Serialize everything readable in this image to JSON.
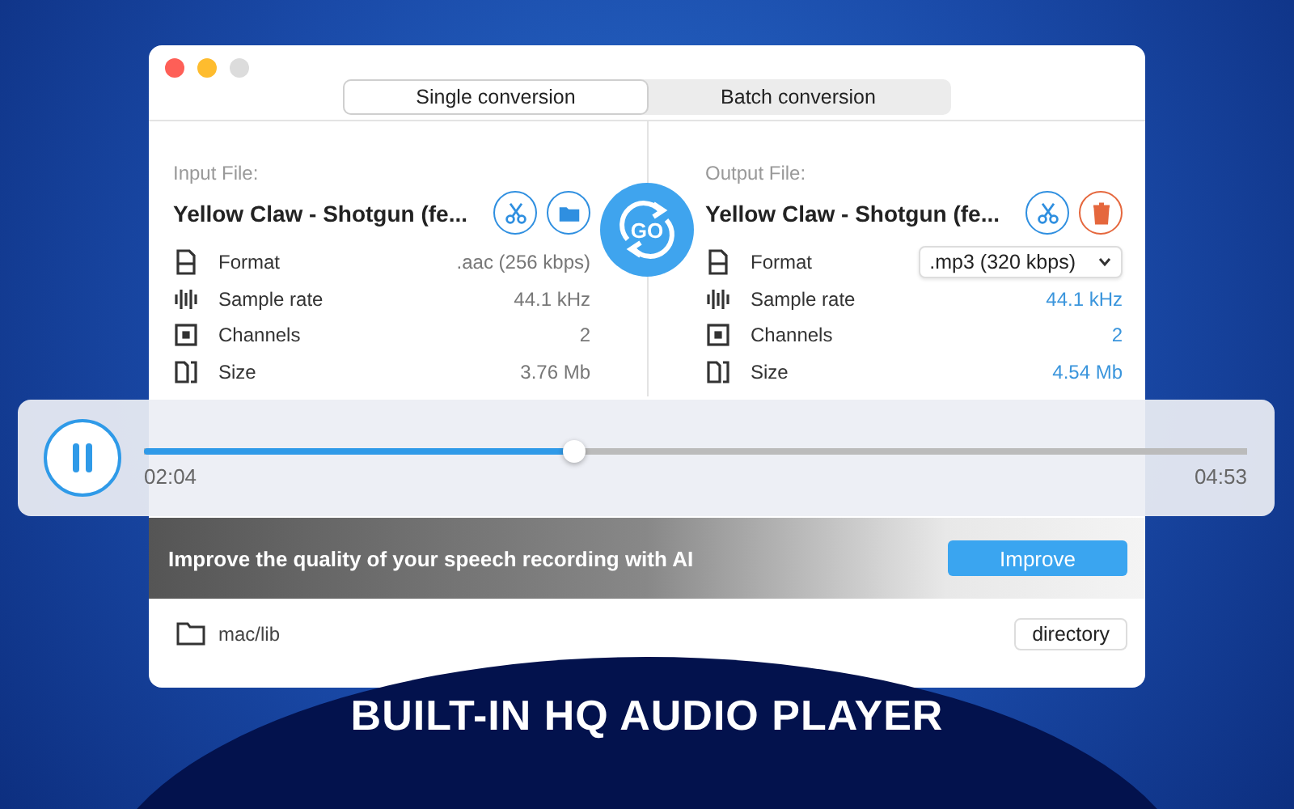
{
  "tabs": [
    {
      "label": "Single conversion",
      "selected": true
    },
    {
      "label": "Batch conversion",
      "selected": false
    }
  ],
  "input": {
    "label": "Input File:",
    "filename": "Yellow Claw - Shotgun (fe...",
    "actions": [
      {
        "kind": "cut"
      },
      {
        "kind": "open"
      }
    ],
    "properties": [
      {
        "kind": "format",
        "name": "Format",
        "value": ".aac (256 kbps)",
        "dropdown": false
      },
      {
        "kind": "sample_rate",
        "name": "Sample rate",
        "value": "44.1 kHz",
        "dropdown": false
      },
      {
        "kind": "channels",
        "name": "Channels",
        "value": "2",
        "dropdown": false
      },
      {
        "kind": "size",
        "name": "Size",
        "value": "3.76 Mb",
        "dropdown": false
      }
    ]
  },
  "go_button": "GO",
  "output": {
    "label": "Output File:",
    "filename": "Yellow Claw - Shotgun (fe...",
    "actions": [
      {
        "kind": "cut"
      },
      {
        "kind": "delete"
      }
    ],
    "properties": [
      {
        "kind": "format",
        "name": "Format",
        "value": ".mp3 (320 kbps)",
        "dropdown": true
      },
      {
        "kind": "sample_rate",
        "name": "Sample rate",
        "value": "44.1 kHz",
        "dropdown": false
      },
      {
        "kind": "channels",
        "name": "Channels",
        "value": "2",
        "dropdown": false
      },
      {
        "kind": "size",
        "name": "Size",
        "value": "4.54 Mb",
        "dropdown": false
      }
    ]
  },
  "player": {
    "playing": true,
    "level": 0.39,
    "elapsed": "02:04",
    "total": "04:53"
  },
  "banner": {
    "text": "Improve the quality of your speech recording with AI",
    "button": "Improve"
  },
  "footer": {
    "path": "mac/lib",
    "button": "directory"
  },
  "headline": "BUILT-IN HQ AUDIO PLAYER"
}
